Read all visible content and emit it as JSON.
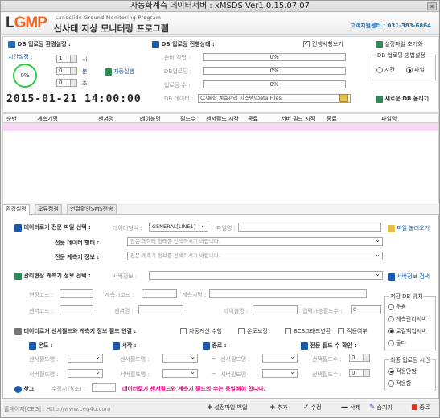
{
  "window": {
    "title": "자동화계측 데이터서버 : xMSDS Ver1.0.15.07.07",
    "close": "x"
  },
  "header": {
    "logo_l": "L",
    "logo_gmp": "GMP",
    "logo_en": "Landslide  Ground  Monitoring  Program",
    "logo_ko": "산사태 지상 모니터링 프로그램",
    "support": "고객지원센터 : 031-383-6864"
  },
  "upload": {
    "title": "DB 업로딩 환경설정 :",
    "time_label": "시간설정 :",
    "percent": "0%",
    "hour_val": "1",
    "hour_unit": "시",
    "min_val": "0",
    "min_unit": "분",
    "sec_val": "0",
    "sec_unit": "초",
    "auto_run": "자동실행",
    "clock": "2015-01-21  14:00:00"
  },
  "status": {
    "title": "DB 업로딩 진행상태 :",
    "show_progress": "진행사항보기",
    "prep_label": "준비 작업 :",
    "prep_val": "0%",
    "upload_label": "DB업로딩 :",
    "upload_val": "0%",
    "count_label": "업로딩 수 :",
    "count_val": "0%",
    "data_label": "DB 데이터 :",
    "data_path": "C:\\통합 계측관리 시스템\\Data Files"
  },
  "right": {
    "reset": "설정파일 초기화",
    "method_title": "DB 업로딩 방법설정",
    "method_time": "시간",
    "method_file": "파일",
    "reload": "새로운 DB 올리기"
  },
  "grid": {
    "columns": [
      "순번",
      "계측기명",
      "센서명",
      "테이블명",
      "필드수",
      "센서필드 시작",
      "종료",
      "서버 필드 시작",
      "종료",
      "파일명"
    ]
  },
  "tabs": [
    "환경설정",
    "오류점검",
    "연결확인SMS전송"
  ],
  "form": {
    "file_select": "데이터로거 전문 파일 선택 :",
    "data_format_label": "데이터형식 :",
    "data_format_val": "GENERAL[LINE1]",
    "filename_label": "파일명 :",
    "file_load": "파일 불러오기",
    "data_shape_label": "전문 데이터 형태 :",
    "data_shape_ph": "전문 데이터 형태를 선택하시기 바랍니다.",
    "instrument_info_label": "전문 계측기 정보 :",
    "instrument_info_ph": "전문 계측기 정보를 선택하시기 바랍니다.",
    "site_select": "관리현장 계측기 정보 선택 :",
    "server_info_label": "서버정보 :",
    "server_search": "서버정보 검색",
    "site_code": "현장코드 :",
    "instrument_code": "계측기코드 :",
    "instrument_name": "계측기명 :",
    "sensor_code": "센서코드 :",
    "sensor_name": "센서명 :",
    "table_name": "테이블명 :",
    "input_count_label": "입력가능필드수 :",
    "input_count_val": "0",
    "field_connect": "데이터로거 센서필드와 계측기 정보 필드 연결 :",
    "auto_calc": "자동계산 수행",
    "temp_correct": "온도보정",
    "bcs_graph": "BCS그래프변환",
    "apply": "적용여부",
    "temp": "온도 :",
    "start": "시작 :",
    "end": "종료 :",
    "field_check": "전문 필드 수 확인 :",
    "sensor_field": "센서필드명 :",
    "server_field": "서버필드명 :",
    "sensor_field2": "센서필드명 :",
    "server_field2": "서버필드명 :",
    "dash": "~",
    "select_count": "선택필드수 :",
    "select_count_val": "0",
    "find": "찾고",
    "receive_time": "수정시간(초) :",
    "warning": "데이터로거 센서필드와 계측기 필드의 수는 동일해야 합니다."
  },
  "storage": {
    "title": "저장 DB 위치",
    "opt1": "운용",
    "opt2": "계측관리서버",
    "opt3": "로컬백업서버",
    "opt4": "둘다"
  },
  "final_time": {
    "title": "최종 업로딩 시간",
    "opt1": "적용안함",
    "opt2": "적용함"
  },
  "footer": {
    "homepage": "홈페이지[CEG] : Http://www.ceg4u.com",
    "backup": "설정파일 백업",
    "add": "추가",
    "edit": "수정",
    "delete": "삭제",
    "hide": "숨기기",
    "exit": "종료"
  }
}
